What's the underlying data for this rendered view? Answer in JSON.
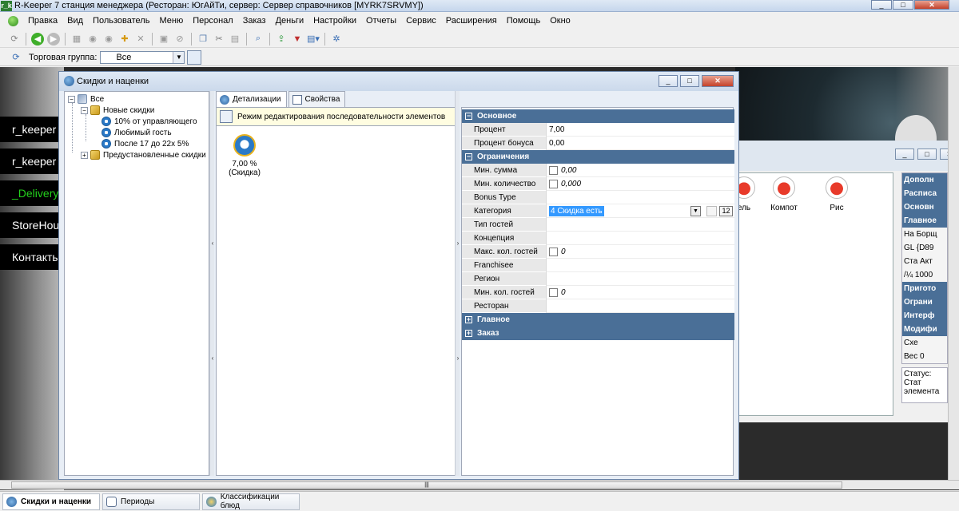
{
  "window": {
    "title": "R-Keeper 7 станция менеджера (Ресторан: ЮгАйТи, сервер: Сервер справочников [MYRK7SRVMY])",
    "app_icon_text": "r_k"
  },
  "menu": [
    "Правка",
    "Вид",
    "Пользователь",
    "Меню",
    "Персонал",
    "Заказ",
    "Деньги",
    "Настройки",
    "Отчеты",
    "Сервис",
    "Расширения",
    "Помощь",
    "Окно"
  ],
  "toolbar": {
    "icons": [
      "refresh-icon",
      "back-icon",
      "forward-icon",
      "grid-icon",
      "disc-icon",
      "disc2-icon",
      "add-icon",
      "delete-icon",
      "save-icon",
      "cancel-icon",
      "copy-icon",
      "cut-icon",
      "paste-icon",
      "search-icon",
      "export-icon",
      "print-icon",
      "view-icon",
      "settings-icon"
    ]
  },
  "group_bar": {
    "label": "Торговая группа:",
    "selected": "Все"
  },
  "background": {
    "left_tiles": [
      "r_keeper",
      "r_keeper",
      "_Delivery",
      "StoreHouse",
      "Контакты"
    ]
  },
  "dialog": {
    "title": "Скидки и наценки",
    "tree": {
      "root": "Все",
      "group1": "Новые скидки",
      "items": [
        "10% от управляющего",
        "Любимый гость",
        "После 17 до 22х 5%"
      ],
      "group2": "Предустановленные скидки"
    },
    "tabs": [
      "Детализации",
      "Свойства"
    ],
    "mode_bar_text": "Режим редактирования последовательности элементов",
    "item": {
      "label_line1": "7,00 %",
      "label_line2": "(Скидка)"
    },
    "props": {
      "sections": {
        "basic": "Основное",
        "limits": "Ограничения",
        "main": "Главное",
        "order": "Заказ"
      },
      "rows": [
        {
          "name": "Процент",
          "value": "7,00"
        },
        {
          "name": "Процент бонуса",
          "value": "0,00"
        },
        {
          "name": "Мин. сумма",
          "value": "0,00"
        },
        {
          "name": "Мин. количество",
          "value": "0,000"
        },
        {
          "name": "Bonus Type",
          "value": ""
        },
        {
          "name": "Категория",
          "value": "4 Скидка есть"
        },
        {
          "name": "Тип гостей",
          "value": ""
        },
        {
          "name": "Концепция",
          "value": ""
        },
        {
          "name": "Макс. кол. гостей",
          "value": "0"
        },
        {
          "name": "Franchisee",
          "value": ""
        },
        {
          "name": "Регион",
          "value": ""
        },
        {
          "name": "Мин. кол. гостей",
          "value": "0"
        },
        {
          "name": "Ресторан",
          "value": ""
        }
      ],
      "category_count": "12"
    }
  },
  "dish_window": {
    "dishes": [
      "ель",
      "Компот",
      "Рис"
    ],
    "props": [
      "Дополн",
      "Расписа",
      "Основн",
      "Главное",
      "На",
      "Борщ",
      "GL",
      "{D89",
      "Ста",
      "Акт",
      "/¼",
      "1000",
      "Пригото",
      "Ограни",
      "Интерф",
      "Модифи",
      "Схе",
      "Вес",
      "0"
    ],
    "status": "Статус: Стат элемента"
  },
  "taskbar": {
    "tasks": [
      "Скидки и наценки",
      "Периоды",
      "Классификации блюд"
    ]
  }
}
